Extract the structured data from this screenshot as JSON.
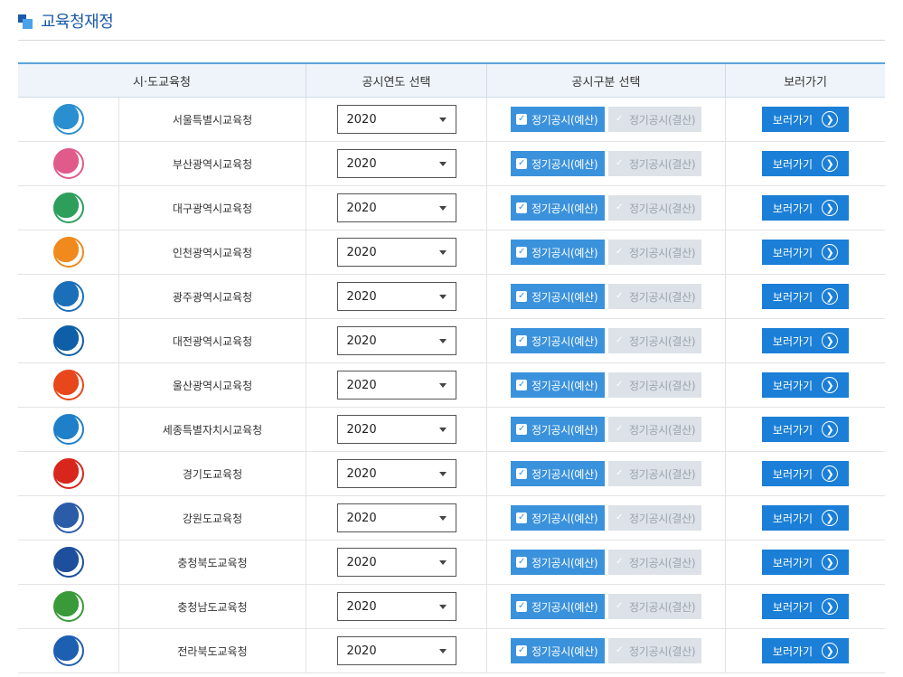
{
  "page": {
    "title": "교육청재정"
  },
  "table": {
    "headers": {
      "office": "시·도교육청",
      "year": "공시연도 선택",
      "type": "공시구분 선택",
      "go": "보러가기"
    },
    "rows": [
      {
        "name": "서울특별시교육청",
        "year": "2020",
        "budget": "정기공시(예산)",
        "settlement": "정기공시(결산)",
        "go": "보러가기",
        "logo_icon": "seoul-edu-logo-icon",
        "logo_color": "#2a8fd0"
      },
      {
        "name": "부산광역시교육청",
        "year": "2020",
        "budget": "정기공시(예산)",
        "settlement": "정기공시(결산)",
        "go": "보러가기",
        "logo_icon": "busan-edu-logo-icon",
        "logo_color": "#e05a8a"
      },
      {
        "name": "대구광역시교육청",
        "year": "2020",
        "budget": "정기공시(예산)",
        "settlement": "정기공시(결산)",
        "go": "보러가기",
        "logo_icon": "daegu-edu-logo-icon",
        "logo_color": "#2e9e5b"
      },
      {
        "name": "인천광역시교육청",
        "year": "2020",
        "budget": "정기공시(예산)",
        "settlement": "정기공시(결산)",
        "go": "보러가기",
        "logo_icon": "incheon-edu-logo-icon",
        "logo_color": "#f08a1c"
      },
      {
        "name": "광주광역시교육청",
        "year": "2020",
        "budget": "정기공시(예산)",
        "settlement": "정기공시(결산)",
        "go": "보러가기",
        "logo_icon": "gwangju-edu-logo-icon",
        "logo_color": "#1b6fb8"
      },
      {
        "name": "대전광역시교육청",
        "year": "2020",
        "budget": "정기공시(예산)",
        "settlement": "정기공시(결산)",
        "go": "보러가기",
        "logo_icon": "daejeon-edu-logo-icon",
        "logo_color": "#0f5ea8"
      },
      {
        "name": "울산광역시교육청",
        "year": "2020",
        "budget": "정기공시(예산)",
        "settlement": "정기공시(결산)",
        "go": "보러가기",
        "logo_icon": "ulsan-edu-logo-icon",
        "logo_color": "#e8471c"
      },
      {
        "name": "세종특별자치시교육청",
        "year": "2020",
        "budget": "정기공시(예산)",
        "settlement": "정기공시(결산)",
        "go": "보러가기",
        "logo_icon": "sejong-edu-logo-icon",
        "logo_color": "#1f7fc8"
      },
      {
        "name": "경기도교육청",
        "year": "2020",
        "budget": "정기공시(예산)",
        "settlement": "정기공시(결산)",
        "go": "보러가기",
        "logo_icon": "gyeonggi-edu-logo-icon",
        "logo_color": "#d9261c"
      },
      {
        "name": "강원도교육청",
        "year": "2020",
        "budget": "정기공시(예산)",
        "settlement": "정기공시(결산)",
        "go": "보러가기",
        "logo_icon": "gangwon-edu-logo-icon",
        "logo_color": "#2a5ca8"
      },
      {
        "name": "충청북도교육청",
        "year": "2020",
        "budget": "정기공시(예산)",
        "settlement": "정기공시(결산)",
        "go": "보러가기",
        "logo_icon": "chungbuk-edu-logo-icon",
        "logo_color": "#1d4f9c"
      },
      {
        "name": "충청남도교육청",
        "year": "2020",
        "budget": "정기공시(예산)",
        "settlement": "정기공시(결산)",
        "go": "보러가기",
        "logo_icon": "chungnam-edu-logo-icon",
        "logo_color": "#3a9a3a"
      },
      {
        "name": "전라북도교육청",
        "year": "2020",
        "budget": "정기공시(예산)",
        "settlement": "정기공시(결산)",
        "go": "보러가기",
        "logo_icon": "jeonbuk-edu-logo-icon",
        "logo_color": "#1d5fb0"
      }
    ]
  },
  "colors": {
    "accent": "#1a5aa8",
    "checked": "#3b92dc",
    "button": "#1b7fd7",
    "disabled": "#dde2e8"
  }
}
